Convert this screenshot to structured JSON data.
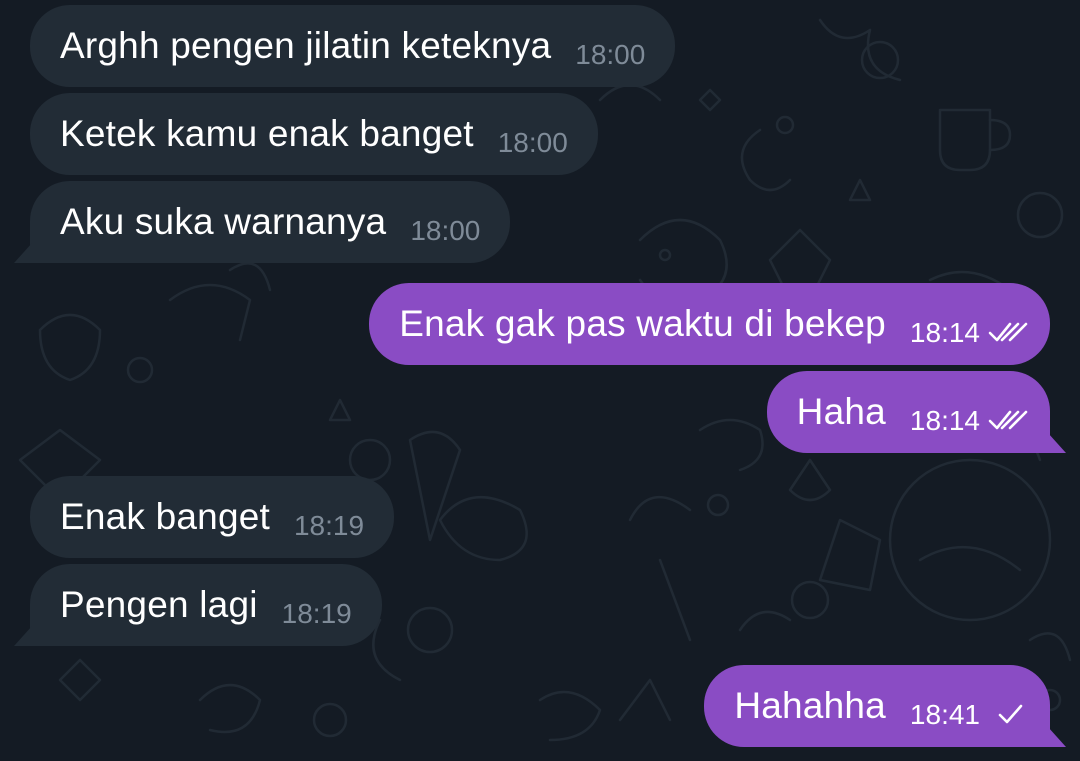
{
  "chat": {
    "messages": [
      {
        "direction": "incoming",
        "text": "Arghh pengen jilatin keteknya",
        "time": "18:00"
      },
      {
        "direction": "incoming",
        "text": "Ketek kamu enak banget",
        "time": "18:00"
      },
      {
        "direction": "incoming",
        "text": "Aku suka warnanya",
        "time": "18:00"
      },
      {
        "direction": "outgoing",
        "text": "Enak gak pas waktu di bekep",
        "time": "18:14",
        "status": "read-double-check-icon"
      },
      {
        "direction": "outgoing",
        "text": "Haha",
        "time": "18:14",
        "status": "read-double-check-icon"
      },
      {
        "direction": "incoming",
        "text": "Enak banget",
        "time": "18:19"
      },
      {
        "direction": "incoming",
        "text": "Pengen lagi",
        "time": "18:19"
      },
      {
        "direction": "outgoing",
        "text": "Hahahha",
        "time": "18:41",
        "status": "sent-single-check-icon"
      }
    ]
  },
  "colors": {
    "background": "#141b24",
    "incoming_bubble": "#222c36",
    "outgoing_bubble": "#8a4cc4",
    "incoming_time": "#7f8b98",
    "text": "#ffffff"
  }
}
